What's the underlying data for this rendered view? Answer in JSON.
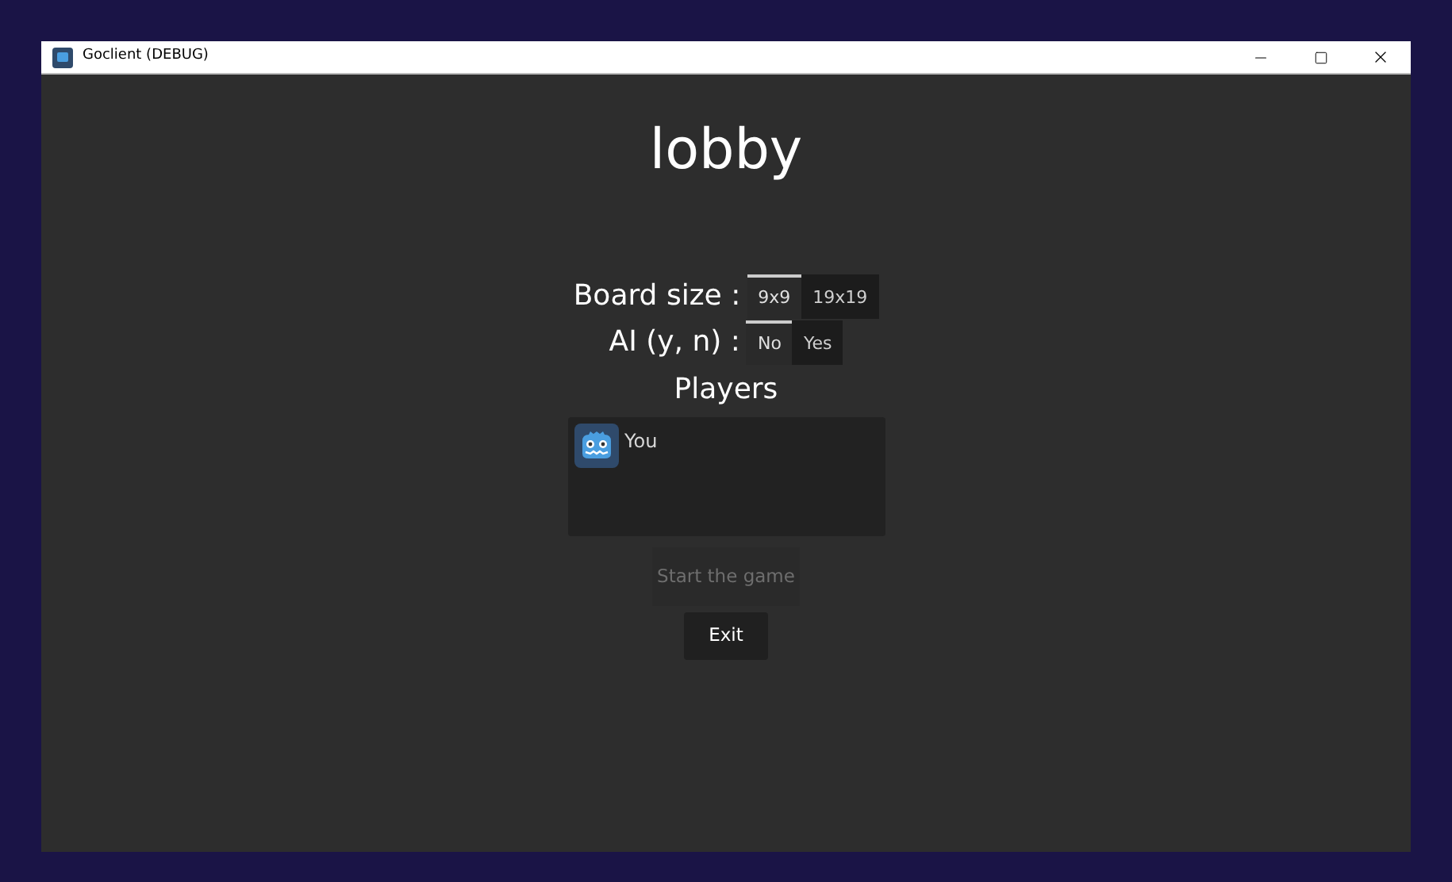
{
  "window": {
    "title": "Goclient (DEBUG)"
  },
  "heading": "lobby",
  "options": [
    {
      "label": "Board size :",
      "choices": [
        {
          "label": "9x9",
          "selected": true
        },
        {
          "label": "19x19",
          "selected": false
        }
      ]
    },
    {
      "label": "AI (y, n) :",
      "choices": [
        {
          "label": "No",
          "selected": true
        },
        {
          "label": "Yes",
          "selected": false
        }
      ]
    }
  ],
  "players": {
    "title": "Players",
    "items": [
      {
        "name": "You"
      }
    ]
  },
  "buttons": [
    {
      "label": "Start the game",
      "disabled": true
    },
    {
      "label": "Exit",
      "disabled": false
    }
  ]
}
